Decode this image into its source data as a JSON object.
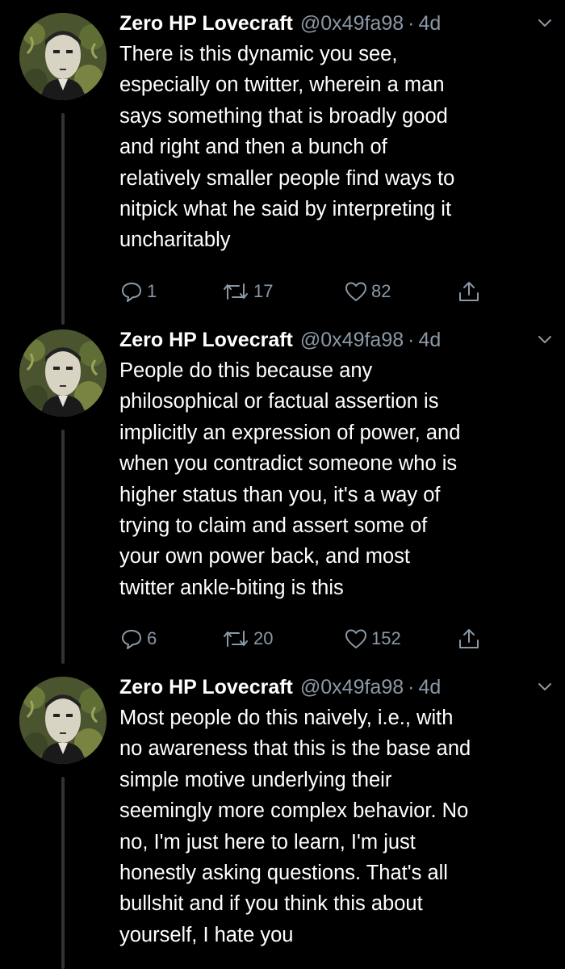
{
  "tweets": [
    {
      "name": "Zero HP Lovecraft",
      "handle": "@0x49fa98",
      "separator": "·",
      "time": "4d",
      "text": "There is this dynamic you see,\nespecially on twitter, wherein a man\nsays something that is broadly good\nand right and then a bunch of\nrelatively smaller people find ways to\nnitpick what he said by interpreting it\nuncharitably",
      "replies": "1",
      "retweets": "17",
      "likes": "82"
    },
    {
      "name": "Zero HP Lovecraft",
      "handle": "@0x49fa98",
      "separator": "·",
      "time": "4d",
      "text": "People do this because any\nphilosophical or factual assertion is\nimplicitly an expression of power, and\nwhen you contradict someone who is\nhigher status than you, it's a way of\ntrying to claim and assert some of\nyour own power back, and most\ntwitter ankle-biting is this",
      "replies": "6",
      "retweets": "20",
      "likes": "152"
    },
    {
      "name": "Zero HP Lovecraft",
      "handle": "@0x49fa98",
      "separator": "·",
      "time": "4d",
      "text": "Most people do this naively, i.e., with\nno awareness that this is the base and\nsimple motive underlying their\nseemingly more complex behavior. No\nno, I'm just here to learn, I'm just\nhonestly asking questions. That's all\nbullshit and if you think this about\nyourself, I hate you"
    }
  ],
  "colors": {
    "background": "#000000",
    "text": "#ffffff",
    "secondary": "#8b98a5",
    "thread_line": "#2f3336"
  },
  "icons": [
    "reply-icon",
    "retweet-icon",
    "like-icon",
    "share-icon",
    "chevron-down-icon"
  ]
}
